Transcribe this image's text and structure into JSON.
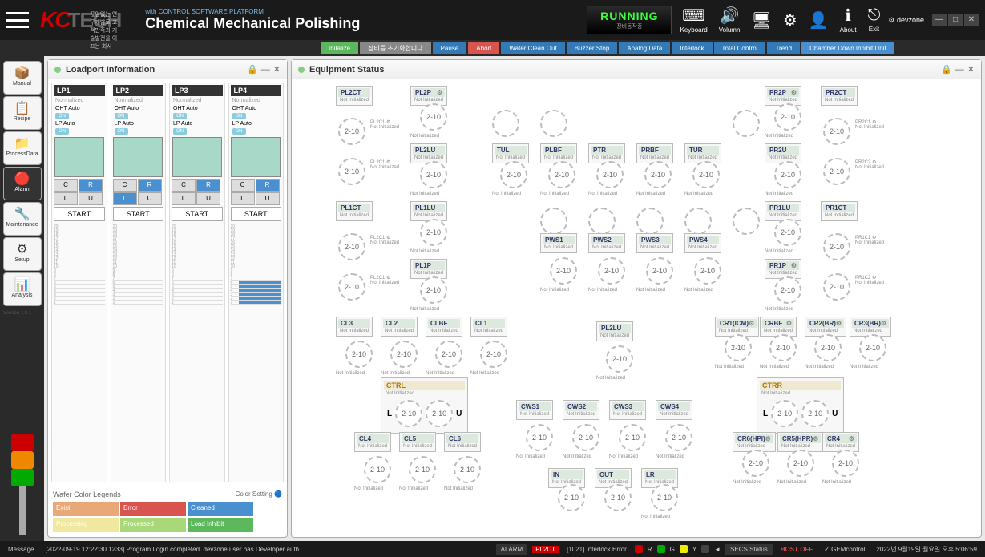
{
  "header": {
    "tagline": "끊임없는 연구개발로 고객만족과 기술발전을 이끄는 회사",
    "with_csp": "with CONTROL SOFTWARE PLATFORM",
    "title": "Chemical Mechanical Polishing",
    "running": "RUNNING",
    "running_sub": "장비동작중",
    "icons": [
      {
        "label": "Keyboard",
        "sym": "⌨"
      },
      {
        "label": "Volumn",
        "sym": "🔊"
      },
      {
        "label": "",
        "sym": "🖥"
      },
      {
        "label": "",
        "sym": "⚙"
      },
      {
        "label": "",
        "sym": "👤"
      },
      {
        "label": "About",
        "sym": "ℹ"
      },
      {
        "label": "Exit",
        "sym": "⎋"
      }
    ],
    "user": "devzone"
  },
  "toolbar": [
    {
      "label": "Initalize",
      "cls": "green"
    },
    {
      "label": "장비를 초기화합니다",
      "cls": "gray"
    },
    {
      "label": "Pause",
      "cls": "darkblue"
    },
    {
      "label": "Abort",
      "cls": "red"
    },
    {
      "label": "Water\nClean Out",
      "cls": "darkblue"
    },
    {
      "label": "Buzzer Stop",
      "cls": "darkblue"
    },
    {
      "label": "Analog Data",
      "cls": "darkblue"
    },
    {
      "label": "Interlock",
      "cls": "darkblue"
    },
    {
      "label": "Total Control",
      "cls": "darkblue"
    },
    {
      "label": "Trend",
      "cls": "darkblue"
    },
    {
      "label": "Chamber Down\nInhibit Unit",
      "cls": ""
    }
  ],
  "sidebar": [
    {
      "label": "Manual",
      "icn": "📦"
    },
    {
      "label": "Recipe",
      "icn": "📋"
    },
    {
      "label": "ProcessData",
      "icn": "📁"
    },
    {
      "label": "Alarm",
      "icn": "🔴"
    },
    {
      "label": "Maintenance",
      "icn": "🔧"
    },
    {
      "label": "Setup",
      "icn": "⚙"
    },
    {
      "label": "Analysis",
      "icn": "📊"
    }
  ],
  "version": "Version 1.0.1",
  "loadport": {
    "title": "Loadport Information",
    "ports": [
      {
        "name": "LP1",
        "status": "Normalized",
        "oht": "OHT Auto",
        "oht_on": "ON",
        "lp": "LP Auto",
        "lp_on": "ON",
        "c": "C",
        "r": "R",
        "l": "L",
        "u": "U",
        "start": "START",
        "slots_from": 20,
        "filled": false
      },
      {
        "name": "LP2",
        "status": "Normalized",
        "oht": "OHT Auto",
        "oht_on": "ON",
        "lp": "LP Auto",
        "lp_on": "ON",
        "c": "C",
        "r": "R",
        "l": "L",
        "u": "U",
        "start": "START",
        "slots_from": 20,
        "filled": false
      },
      {
        "name": "LP3",
        "status": "Normalized",
        "oht": "OHT Auto",
        "oht_on": "ON",
        "lp": "LP Auto",
        "lp_on": "ON",
        "c": "C",
        "r": "R",
        "l": "L",
        "u": "U",
        "start": "START",
        "slots_from": 20,
        "filled": false
      },
      {
        "name": "LP4",
        "status": "Normalized",
        "oht": "OHT Auto",
        "oht_on": "ON",
        "lp": "LP Auto",
        "lp_on": "ON",
        "c": "C",
        "r": "R",
        "l": "L",
        "u": "U",
        "start": "START",
        "slots_from": 20,
        "filled": true
      }
    ],
    "legends": {
      "title": "Wafer Color Legends",
      "color_setting": "Color Setting",
      "items": [
        {
          "label": "Exist",
          "color": "#e8a878"
        },
        {
          "label": "Error",
          "color": "#d9534f"
        },
        {
          "label": "Cleaned",
          "color": "#4a90d0"
        },
        {
          "label": "Processing",
          "color": "#f0e8a0"
        },
        {
          "label": "Processed",
          "color": "#a8d878"
        },
        {
          "label": "Load Inhibit",
          "color": "#5cb85c"
        }
      ]
    }
  },
  "equip": {
    "title": "Equipment Status",
    "not_init": "Not Initialized",
    "val": "2-10"
  },
  "ctrl_l": "CTRL",
  "ctrl_r": "CTRR",
  "statusbar": {
    "message_label": "Message",
    "message": "[2022-09-19 12:22:30.1233] Program Login completed. devzone user has Developer auth.",
    "alarm": "ALARM",
    "alarm_unit": "PL2CT",
    "alarm_msg": "[1021] Interlock Error",
    "secs": "SECS Status",
    "host": "HOST OFF",
    "gem": "GEMcontrol",
    "datetime": "2022년 9월19일 월요일 오후 5:06:59"
  }
}
